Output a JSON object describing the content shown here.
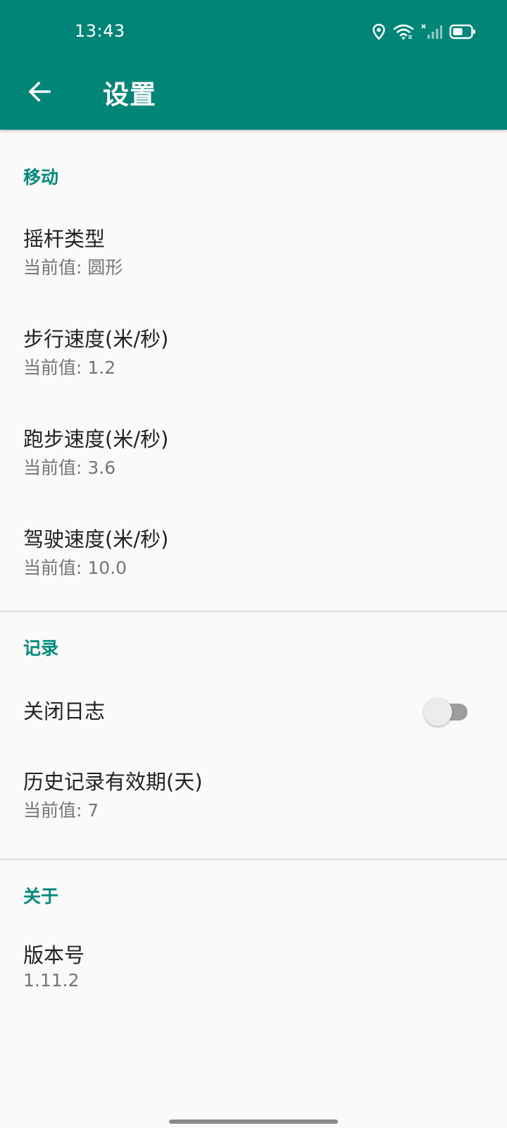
{
  "status_bar": {
    "time": "13:43",
    "icons": [
      "location-icon",
      "wifi-icon",
      "cellular-no-signal-icon",
      "battery-icon"
    ]
  },
  "toolbar": {
    "title": "设置",
    "back_icon": "arrow-left-icon"
  },
  "colors": {
    "primary": "#008577",
    "accent": "#00897b",
    "background": "#fafafa"
  },
  "sections": {
    "movement": {
      "title": "移动",
      "items": [
        {
          "title": "摇杆类型",
          "summary": "当前值: 圆形"
        },
        {
          "title": "步行速度(米/秒)",
          "summary": "当前值: 1.2"
        },
        {
          "title": "跑步速度(米/秒)",
          "summary": "当前值: 3.6"
        },
        {
          "title": "驾驶速度(米/秒)",
          "summary": "当前值: 10.0"
        }
      ]
    },
    "record": {
      "title": "记录",
      "items": [
        {
          "title": "关闭日志",
          "switch_on": false
        },
        {
          "title": "历史记录有效期(天)",
          "summary": "当前值: 7"
        }
      ]
    },
    "about": {
      "title": "关于",
      "items": [
        {
          "title": "版本号",
          "summary": "1.11.2"
        }
      ]
    }
  }
}
